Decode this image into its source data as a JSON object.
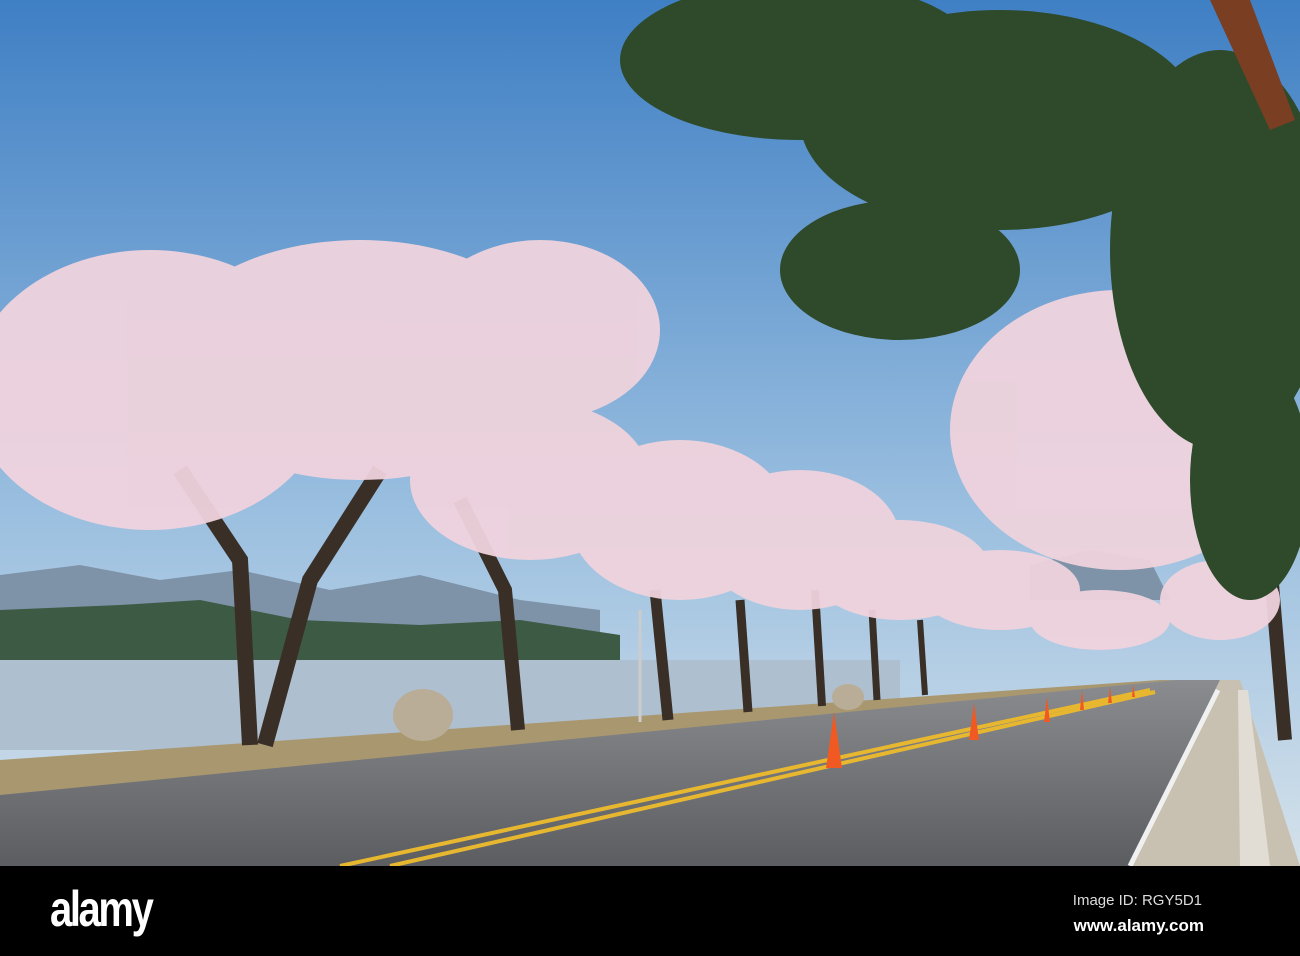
{
  "watermark": {
    "logo": "alamy",
    "image_id": "Image ID: RGY5D1",
    "url": "www.alamy.com"
  },
  "colors": {
    "sky_top": "#3f7fc4",
    "sky_bottom": "#c9dceb",
    "blossom": "#efd3dd",
    "pine": "#2e4a2a",
    "road": "#6c6e72",
    "lake": "#aebfcf",
    "cone": "#f05a22",
    "lane": "#e8b730"
  }
}
